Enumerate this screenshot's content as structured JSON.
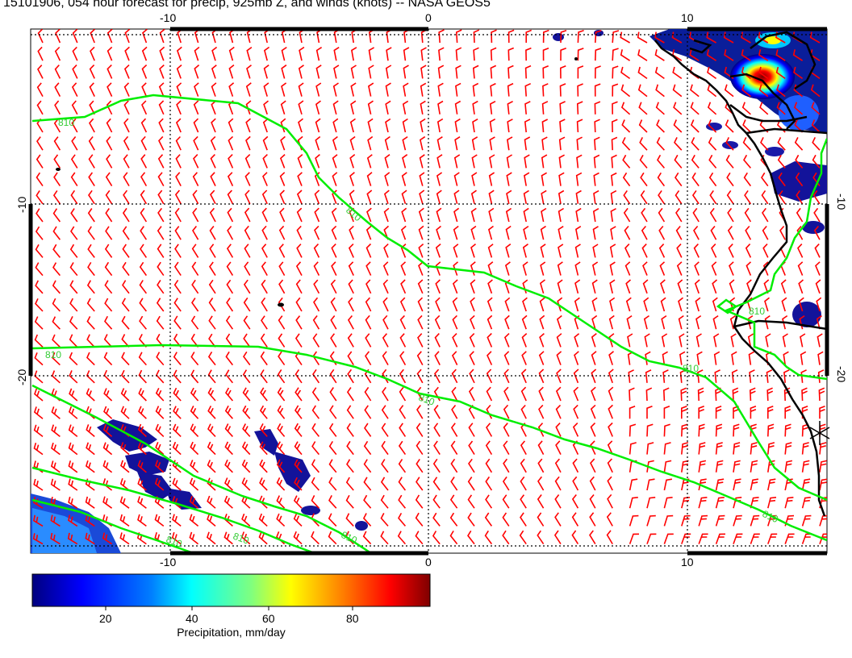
{
  "title": "15101906, 054 hour forecast for precip, 925mb Z, and winds (knots) -- NASA GEOS5",
  "axes": {
    "x_ticks": [
      "-10",
      "0",
      "10"
    ],
    "y_ticks": [
      "-10",
      "-20"
    ]
  },
  "contour_label": "810",
  "colorbar": {
    "label": "Precipitation, mm/day",
    "ticks": [
      "20",
      "40",
      "60",
      "80"
    ],
    "colors": [
      "#00007f",
      "#0000ff",
      "#007fff",
      "#00ffff",
      "#7fff7f",
      "#ffff00",
      "#ff7f00",
      "#ff0000",
      "#7f0000"
    ]
  },
  "colors": {
    "wind_barb": "#ff0000",
    "contour": "#00ee00",
    "coastline": "#000000",
    "grid": "#000000"
  },
  "icons": [
    "north-arrow-icon"
  ]
}
